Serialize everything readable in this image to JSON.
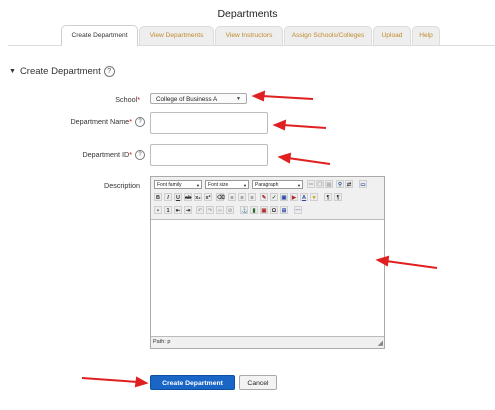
{
  "page": {
    "title": "Departments"
  },
  "tabs": [
    {
      "label": "Create Department",
      "active": true
    },
    {
      "label": "View Departments",
      "active": false
    },
    {
      "label": "View Instructors",
      "active": false
    },
    {
      "label": "Assign Schools/Colleges",
      "active": false
    },
    {
      "label": "Upload",
      "active": false
    },
    {
      "label": "Help",
      "active": false
    }
  ],
  "section": {
    "title": "Create Department",
    "toggle": "▼",
    "help": "?"
  },
  "form": {
    "school": {
      "label": "School",
      "required_mark": "*",
      "value": "College of Business A"
    },
    "department_name": {
      "label": "Department Name",
      "required_mark": "*",
      "help": "?",
      "value": ""
    },
    "department_id": {
      "label": "Department ID",
      "required_mark": "*",
      "help": "?",
      "value": ""
    },
    "description": {
      "label": "Description"
    }
  },
  "editor": {
    "font_family": "Font family",
    "font_size": "Font size",
    "format": "Paragraph",
    "status_path": "Path: p",
    "toolbar_icons": [
      "bold-icon",
      "italic-icon",
      "underline-icon",
      "strikethrough-icon",
      "subscript-icon",
      "superscript-icon",
      "align-left-icon",
      "align-center-icon",
      "align-right-icon",
      "undo-icon",
      "redo-icon",
      "find-replace-icon",
      "image-icon",
      "link-icon",
      "unlink-icon",
      "text-color-icon",
      "highlight-icon",
      "bullet-list-icon",
      "number-list-icon",
      "outdent-icon",
      "indent-icon",
      "special-char-icon",
      "table-icon",
      "html-icon"
    ]
  },
  "buttons": {
    "submit": "Create Department",
    "cancel": "Cancel"
  },
  "colors": {
    "annotation_arrow": "#e02020",
    "primary_button": "#1a66c6",
    "tab_link": "#c08a2e",
    "required": "#cc0000"
  }
}
